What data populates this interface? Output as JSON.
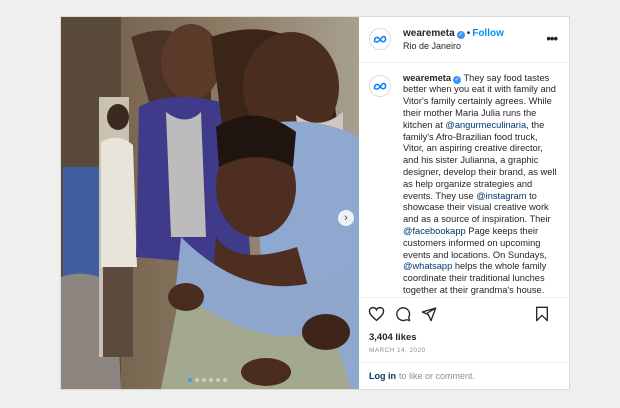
{
  "post": {
    "username": "wearemeta",
    "separator": "•",
    "follow_label": "Follow",
    "location": "Rio de Janeiro",
    "more_icon": "more-options-icon",
    "caption": {
      "p1": " They say food tastes better when you eat it with family and Vitor's family certainly agrees. While their mother Maria Julia runs the kitchen at ",
      "m1": "@angurmeculinaria",
      "p2": ", the family's Afro-Brazilian food truck, Vitor, an aspiring creative director, and his sister Julianna, a graphic designer, develop their brand, as well as help organize strategies and events. They use ",
      "m2": "@instagram",
      "p3": " to showcase their visual creative work and as a source of inspiration. Their ",
      "m3": "@facebookapp",
      "p4": " Page keeps their customers informed on upcoming events and locations. On Sundays, ",
      "m4": "@whatsapp",
      "p5": " helps the whole family coordinate their traditional lunches together at their grandma's house."
    },
    "likes": "3,404 likes",
    "date": "MARCH 14, 2020",
    "login_link": "Log in",
    "login_rest": "to like or comment.",
    "carousel": {
      "count": 6,
      "active_index": 0
    },
    "icons": [
      "heart-icon",
      "comment-icon",
      "share-icon",
      "bookmark-icon",
      "verified-badge-icon",
      "meta-logo-icon",
      "chevron-right-icon"
    ],
    "colors": {
      "accent": "#0095f6",
      "verified": "#3897f0",
      "mention": "#00376b",
      "muted": "#8e8e8e"
    }
  }
}
